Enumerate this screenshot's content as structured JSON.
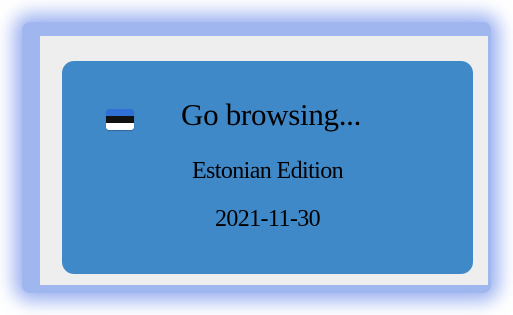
{
  "card": {
    "title": "Go browsing...",
    "subtitle": "Estonian Edition",
    "date": "2021-11-30",
    "flag_icon": "estonia-flag-icon",
    "flag_colors": [
      "#2f6fd6",
      "#111111",
      "#ffffff"
    ]
  },
  "colors": {
    "card_background": "#4089c8",
    "panel_background": "#eeeeee",
    "glow": "#9fb6ee",
    "text": "#ffffff"
  }
}
